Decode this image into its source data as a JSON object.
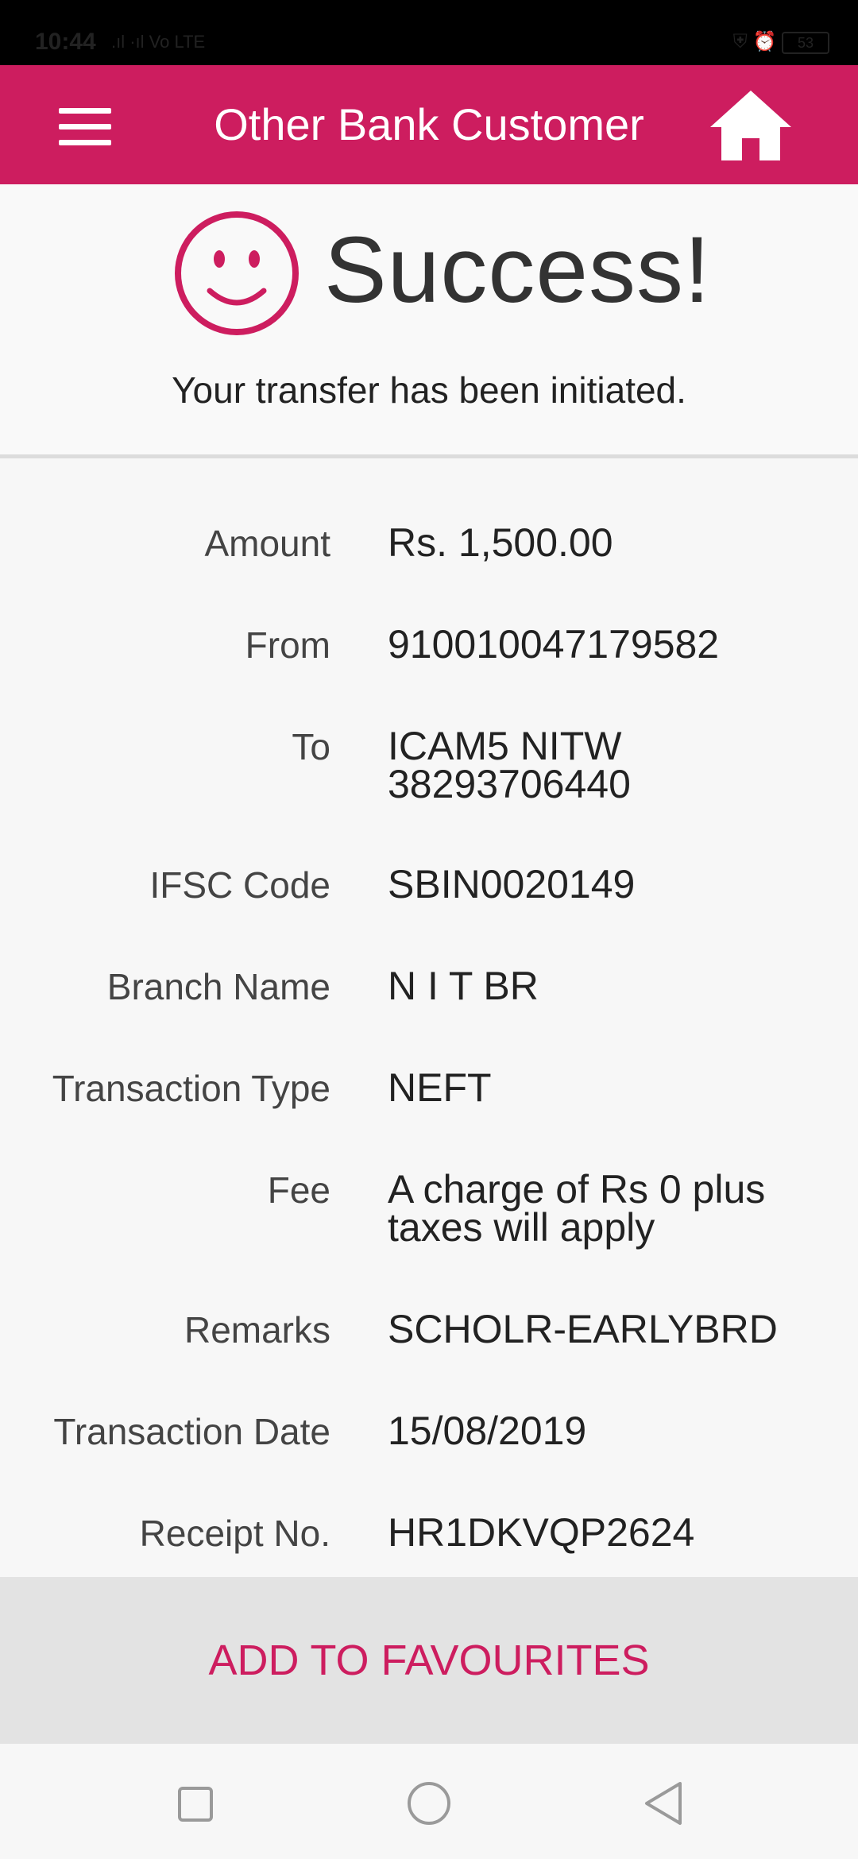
{
  "status_bar": {
    "time": "10:44",
    "left_icons": ".ıl ·ıl Vo LTE",
    "battery": "53"
  },
  "app_bar": {
    "title": "Other Bank Customer"
  },
  "success": {
    "title": "Success!",
    "subtitle": "Your transfer has been initiated."
  },
  "details": [
    {
      "label": "Amount",
      "value": "Rs. 1,500.00"
    },
    {
      "label": "From",
      "value": "910010047179582"
    },
    {
      "label": "To",
      "value_line1": "ICAM5 NITW",
      "value_line2": "38293706440"
    },
    {
      "label": "IFSC Code",
      "value": "SBIN0020149"
    },
    {
      "label": "Branch Name",
      "value": "N I T BR"
    },
    {
      "label": "Transaction Type",
      "value": "NEFT"
    },
    {
      "label": "Fee",
      "value_line1": "A charge of Rs 0 plus",
      "value_line2": "taxes will apply"
    },
    {
      "label": "Remarks",
      "value": "SCHOLR-EARLYBRD"
    },
    {
      "label": "Transaction Date",
      "value": "15/08/2019"
    },
    {
      "label": "Receipt No.",
      "value": "HR1DKVQP2624"
    }
  ],
  "actions": {
    "add_to_favourites": "ADD TO FAVOURITES"
  },
  "colors": {
    "brand": "#cd1d5f",
    "footer_bg": "#e3e3e3"
  },
  "icons": {
    "menu": "hamburger-menu-icon",
    "home": "home-icon",
    "success": "smiley-icon",
    "nav_recent": "square-icon",
    "nav_home": "circle-icon",
    "nav_back": "triangle-back-icon"
  }
}
